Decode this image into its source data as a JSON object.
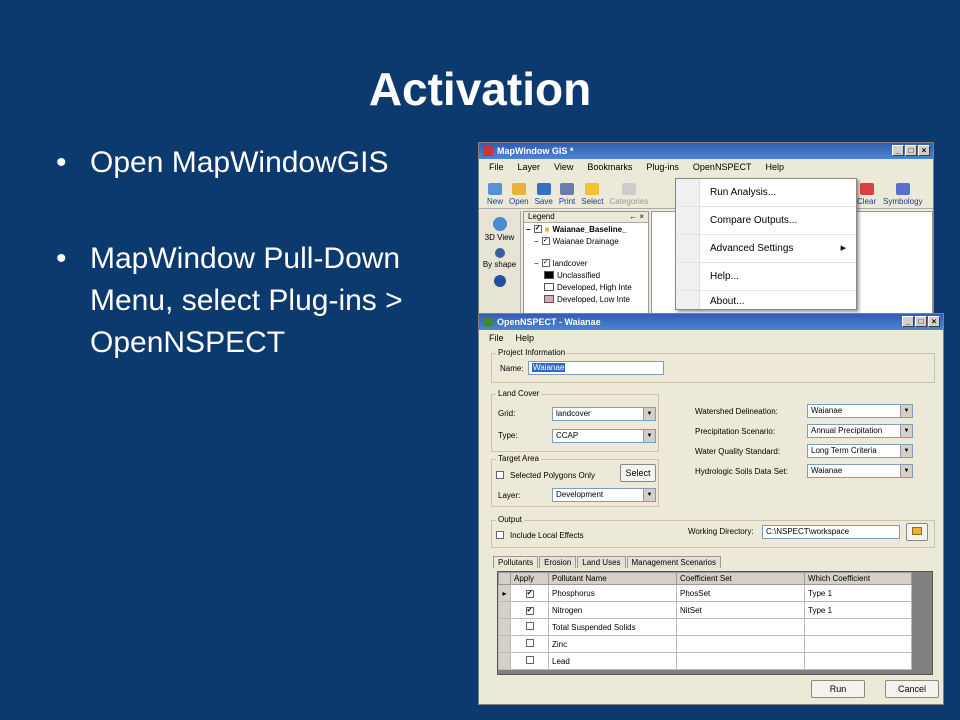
{
  "slide": {
    "title": "Activation",
    "bullets": [
      "Open MapWindowGIS",
      "MapWindow Pull-Down Menu, select Plug-ins > OpenNSPECT"
    ]
  },
  "mapwindow": {
    "title": "MapWindow GIS *",
    "menu": [
      "File",
      "Layer",
      "View",
      "Bookmarks",
      "Plug-ins",
      "OpenNSPECT",
      "Help"
    ],
    "toolbar": [
      "New",
      "Open",
      "Save",
      "Print",
      "Select",
      "Categories",
      "Clear",
      "Symbology"
    ],
    "side": [
      "3D View",
      "By shape"
    ],
    "legend": {
      "title": "Legend",
      "pin": "← ×",
      "group": "Waianae_Baseline_",
      "layer1": "Waianae Drainage",
      "layer2": "landcover",
      "classes": [
        "Unclassified",
        "Developed, High Inte",
        "Developed, Low Inte"
      ]
    }
  },
  "dropdown": {
    "items": [
      "Run Analysis...",
      "Compare Outputs...",
      "Advanced Settings",
      "Help...",
      "About..."
    ]
  },
  "nspect": {
    "title": "OpenNSPECT - Waianae",
    "menu": [
      "File",
      "Help"
    ],
    "project": {
      "label": "Project Information",
      "name_label": "Name:",
      "name_value": "Waianae"
    },
    "landcover": {
      "label": "Land Cover",
      "grid_label": "Grid:",
      "grid_value": "landcover",
      "type_label": "Type:",
      "type_value": "CCAP"
    },
    "target": {
      "label": "Target Area",
      "selected_label": "Selected Polygons Only",
      "select_button": "Select",
      "layer_label": "Layer:",
      "layer_value": "Development"
    },
    "right": {
      "watershed_label": "Watershed Delineation:",
      "watershed_value": "Waianae",
      "precip_label": "Precipitation Scenario:",
      "precip_value": "Annual Precipitation",
      "wq_label": "Water Quality Standard:",
      "wq_value": "Long Term Criteria",
      "soils_label": "Hydrologic Soils Data Set:",
      "soils_value": "Waianae"
    },
    "output": {
      "label": "Output",
      "local_label": "Include Local Effects",
      "workdir_label": "Working Directory:",
      "workdir_value": "C:\\NSPECT\\workspace"
    },
    "tabs": [
      "Pollutants",
      "Erosion",
      "Land Uses",
      "Management Scenarios"
    ],
    "columns": [
      "Apply",
      "Pollutant Name",
      "Coefficient Set",
      "Which Coefficient"
    ],
    "rows": [
      {
        "apply": "✔",
        "name": "Phosphorus",
        "coef": "PhosSet",
        "which": "Type 1"
      },
      {
        "apply": "✔",
        "name": "Nitrogen",
        "coef": "NitSet",
        "which": "Type 1"
      },
      {
        "apply": "",
        "name": "Total Suspended Solids",
        "coef": "",
        "which": ""
      },
      {
        "apply": "",
        "name": "Zinc",
        "coef": "",
        "which": ""
      },
      {
        "apply": "",
        "name": "Lead",
        "coef": "",
        "which": ""
      }
    ],
    "run_label": "Run",
    "cancel_label": "Cancel"
  },
  "icons": {
    "min": "_",
    "max": "□",
    "close": "×",
    "dd": "▼",
    "submenu": "▶",
    "row_pointer": "▸",
    "folder": "📂"
  }
}
